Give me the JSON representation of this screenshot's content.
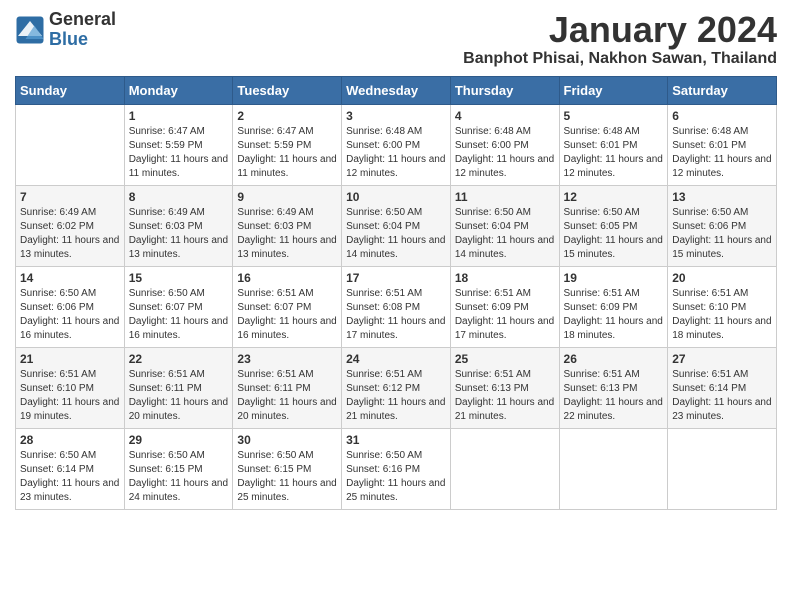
{
  "logo": {
    "general": "General",
    "blue": "Blue"
  },
  "title": "January 2024",
  "subtitle": "Banphot Phisai, Nakhon Sawan, Thailand",
  "days_of_week": [
    "Sunday",
    "Monday",
    "Tuesday",
    "Wednesday",
    "Thursday",
    "Friday",
    "Saturday"
  ],
  "weeks": [
    [
      {
        "day": "",
        "info": ""
      },
      {
        "day": "1",
        "info": "Sunrise: 6:47 AM\nSunset: 5:59 PM\nDaylight: 11 hours\nand 11 minutes."
      },
      {
        "day": "2",
        "info": "Sunrise: 6:47 AM\nSunset: 5:59 PM\nDaylight: 11 hours\nand 11 minutes."
      },
      {
        "day": "3",
        "info": "Sunrise: 6:48 AM\nSunset: 6:00 PM\nDaylight: 11 hours\nand 12 minutes."
      },
      {
        "day": "4",
        "info": "Sunrise: 6:48 AM\nSunset: 6:00 PM\nDaylight: 11 hours\nand 12 minutes."
      },
      {
        "day": "5",
        "info": "Sunrise: 6:48 AM\nSunset: 6:01 PM\nDaylight: 11 hours\nand 12 minutes."
      },
      {
        "day": "6",
        "info": "Sunrise: 6:48 AM\nSunset: 6:01 PM\nDaylight: 11 hours\nand 12 minutes."
      }
    ],
    [
      {
        "day": "7",
        "info": "Sunrise: 6:49 AM\nSunset: 6:02 PM\nDaylight: 11 hours\nand 13 minutes."
      },
      {
        "day": "8",
        "info": "Sunrise: 6:49 AM\nSunset: 6:03 PM\nDaylight: 11 hours\nand 13 minutes."
      },
      {
        "day": "9",
        "info": "Sunrise: 6:49 AM\nSunset: 6:03 PM\nDaylight: 11 hours\nand 13 minutes."
      },
      {
        "day": "10",
        "info": "Sunrise: 6:50 AM\nSunset: 6:04 PM\nDaylight: 11 hours\nand 14 minutes."
      },
      {
        "day": "11",
        "info": "Sunrise: 6:50 AM\nSunset: 6:04 PM\nDaylight: 11 hours\nand 14 minutes."
      },
      {
        "day": "12",
        "info": "Sunrise: 6:50 AM\nSunset: 6:05 PM\nDaylight: 11 hours\nand 15 minutes."
      },
      {
        "day": "13",
        "info": "Sunrise: 6:50 AM\nSunset: 6:06 PM\nDaylight: 11 hours\nand 15 minutes."
      }
    ],
    [
      {
        "day": "14",
        "info": "Sunrise: 6:50 AM\nSunset: 6:06 PM\nDaylight: 11 hours\nand 16 minutes."
      },
      {
        "day": "15",
        "info": "Sunrise: 6:50 AM\nSunset: 6:07 PM\nDaylight: 11 hours\nand 16 minutes."
      },
      {
        "day": "16",
        "info": "Sunrise: 6:51 AM\nSunset: 6:07 PM\nDaylight: 11 hours\nand 16 minutes."
      },
      {
        "day": "17",
        "info": "Sunrise: 6:51 AM\nSunset: 6:08 PM\nDaylight: 11 hours\nand 17 minutes."
      },
      {
        "day": "18",
        "info": "Sunrise: 6:51 AM\nSunset: 6:09 PM\nDaylight: 11 hours\nand 17 minutes."
      },
      {
        "day": "19",
        "info": "Sunrise: 6:51 AM\nSunset: 6:09 PM\nDaylight: 11 hours\nand 18 minutes."
      },
      {
        "day": "20",
        "info": "Sunrise: 6:51 AM\nSunset: 6:10 PM\nDaylight: 11 hours\nand 18 minutes."
      }
    ],
    [
      {
        "day": "21",
        "info": "Sunrise: 6:51 AM\nSunset: 6:10 PM\nDaylight: 11 hours\nand 19 minutes."
      },
      {
        "day": "22",
        "info": "Sunrise: 6:51 AM\nSunset: 6:11 PM\nDaylight: 11 hours\nand 20 minutes."
      },
      {
        "day": "23",
        "info": "Sunrise: 6:51 AM\nSunset: 6:11 PM\nDaylight: 11 hours\nand 20 minutes."
      },
      {
        "day": "24",
        "info": "Sunrise: 6:51 AM\nSunset: 6:12 PM\nDaylight: 11 hours\nand 21 minutes."
      },
      {
        "day": "25",
        "info": "Sunrise: 6:51 AM\nSunset: 6:13 PM\nDaylight: 11 hours\nand 21 minutes."
      },
      {
        "day": "26",
        "info": "Sunrise: 6:51 AM\nSunset: 6:13 PM\nDaylight: 11 hours\nand 22 minutes."
      },
      {
        "day": "27",
        "info": "Sunrise: 6:51 AM\nSunset: 6:14 PM\nDaylight: 11 hours\nand 23 minutes."
      }
    ],
    [
      {
        "day": "28",
        "info": "Sunrise: 6:50 AM\nSunset: 6:14 PM\nDaylight: 11 hours\nand 23 minutes."
      },
      {
        "day": "29",
        "info": "Sunrise: 6:50 AM\nSunset: 6:15 PM\nDaylight: 11 hours\nand 24 minutes."
      },
      {
        "day": "30",
        "info": "Sunrise: 6:50 AM\nSunset: 6:15 PM\nDaylight: 11 hours\nand 25 minutes."
      },
      {
        "day": "31",
        "info": "Sunrise: 6:50 AM\nSunset: 6:16 PM\nDaylight: 11 hours\nand 25 minutes."
      },
      {
        "day": "",
        "info": ""
      },
      {
        "day": "",
        "info": ""
      },
      {
        "day": "",
        "info": ""
      }
    ]
  ]
}
